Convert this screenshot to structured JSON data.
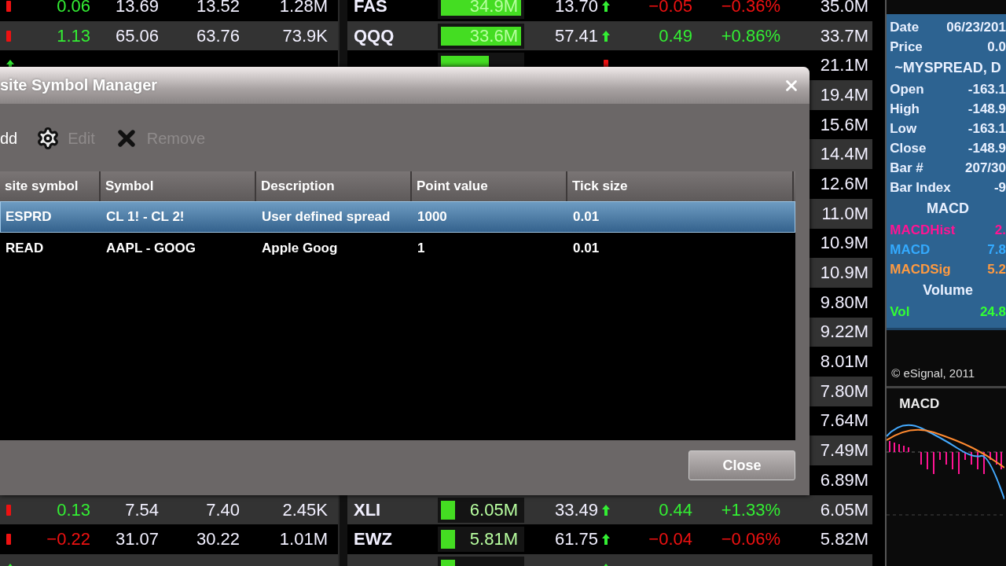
{
  "quotes": [
    {
      "left": {
        "rising": false,
        "change": "0.06",
        "up": true,
        "col_3": "13.69",
        "col_4": "13.52",
        "volume": "1.28M"
      },
      "right": {
        "symbol": "FAS",
        "level": 1,
        "bar_text": "34.9M",
        "price": "13.70",
        "rising": true,
        "change": "−0.05",
        "pct": "−0.36%",
        "up": false,
        "volume": "35.0M"
      }
    },
    {
      "left": {
        "rising": false,
        "change": "1.13",
        "up": true,
        "col_3": "65.06",
        "col_4": "63.76",
        "volume": "73.9K"
      },
      "right": {
        "symbol": "QQQ",
        "level": 1,
        "bar_text": "33.6M",
        "price": "57.41",
        "rising": true,
        "change": "0.49",
        "pct": "+0.86%",
        "up": true,
        "volume": "33.7M"
      }
    },
    {
      "left": {
        "rising": true
      },
      "right": {
        "level": 0.6,
        "rising": false,
        "volume": "21.1M"
      }
    },
    {
      "right": {
        "volume": "19.4M"
      }
    },
    {
      "right": {
        "volume": "15.6M"
      }
    },
    {
      "right": {
        "volume": "14.4M"
      }
    },
    {
      "right": {
        "volume": "12.6M"
      }
    },
    {
      "right": {
        "volume": "11.0M"
      }
    },
    {
      "right": {
        "volume": "10.9M"
      }
    },
    {
      "right": {
        "volume": "10.9M"
      }
    },
    {
      "right": {
        "volume": "9.80M"
      }
    },
    {
      "right": {
        "volume": "9.22M"
      }
    },
    {
      "right": {
        "volume": "8.01M"
      }
    },
    {
      "right": {
        "volume": "7.80M"
      }
    },
    {
      "right": {
        "volume": "7.64M"
      }
    },
    {
      "right": {
        "volume": "7.49M"
      }
    },
    {
      "right": {
        "volume": "6.89M"
      }
    },
    {
      "left": {
        "rising": false,
        "change": "0.13",
        "up": true,
        "col_3": "7.54",
        "col_4": "7.40",
        "volume": "2.45K"
      },
      "right": {
        "symbol": "XLI",
        "level": 0.18,
        "bar_text": "6.05M",
        "price": "33.49",
        "rising": true,
        "change": "0.44",
        "pct": "+1.33%",
        "up": true,
        "volume": "6.05M"
      }
    },
    {
      "left": {
        "rising": false,
        "change": "−0.22",
        "up": false,
        "col_3": "31.07",
        "col_4": "30.22",
        "volume": "1.01M"
      },
      "right": {
        "symbol": "EWZ",
        "level": 0.18,
        "bar_text": "5.81M",
        "price": "61.75",
        "rising": true,
        "change": "−0.04",
        "pct": "−0.06%",
        "up": false,
        "volume": "5.82M"
      }
    },
    {
      "left": {
        "rising": true
      },
      "right": {
        "level": 0.18,
        "rising": true
      }
    }
  ],
  "data_window": [
    {
      "kind": "field",
      "label": "Date",
      "value": "06/23/201",
      "color": "#e8f0ff"
    },
    {
      "kind": "field",
      "label": "Price",
      "value": "0.0",
      "color": "#e8f0ff"
    },
    {
      "kind": "heading",
      "label": "~MYSPREAD, D"
    },
    {
      "kind": "field",
      "label": "Open",
      "value": "-163.1",
      "color": "#e8f0ff"
    },
    {
      "kind": "field",
      "label": "High",
      "value": "-148.9",
      "color": "#e8f0ff"
    },
    {
      "kind": "field",
      "label": "Low",
      "value": "-163.1",
      "color": "#e8f0ff"
    },
    {
      "kind": "field",
      "label": "Close",
      "value": "-148.9",
      "color": "#e8f0ff"
    },
    {
      "kind": "field",
      "label": "Bar #",
      "value": "207/30",
      "color": "#e8f0ff"
    },
    {
      "kind": "field",
      "label": "Bar Index",
      "value": "-9",
      "color": "#e8f0ff"
    },
    {
      "kind": "heading",
      "label": "MACD"
    },
    {
      "kind": "field",
      "label": "MACDHist",
      "value": "2.",
      "color": "#ff1493"
    },
    {
      "kind": "field",
      "label": "MACD",
      "value": "7.8",
      "color": "#33aaff"
    },
    {
      "kind": "field",
      "label": "MACDSig",
      "value": "5.2",
      "color": "#ff9a40"
    },
    {
      "kind": "heading",
      "label": "Volume"
    },
    {
      "kind": "field",
      "label": "Vol",
      "value": "24.8",
      "color": "#33ff33"
    }
  ],
  "copyright": "© eSignal, 2011",
  "chart_title": "MACD",
  "dialog": {
    "title": "site Symbol Manager",
    "toolbar": [
      {
        "kind": "add",
        "label": "dd",
        "disabled": false
      },
      {
        "kind": "edit",
        "label": "Edit",
        "disabled": true
      },
      {
        "kind": "remove",
        "label": "Remove",
        "disabled": true
      }
    ],
    "columns": [
      "site symbol",
      "Symbol",
      "Description",
      "Point value",
      "Tick size"
    ],
    "rows": [
      {
        "cells": [
          "ESPRD",
          "CL 1! - CL 2!",
          "User defined spread",
          "1000",
          "0.01"
        ],
        "selected": true
      },
      {
        "cells": [
          "READ",
          "AAPL - GOOG",
          "Apple Goog",
          "1",
          "0.01"
        ],
        "selected": false
      }
    ],
    "close_button": "Close"
  }
}
